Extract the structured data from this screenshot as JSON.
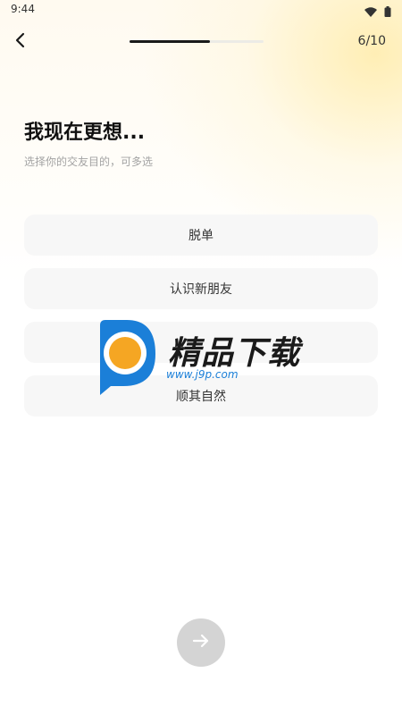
{
  "status_bar": {
    "time": "9:44",
    "icons": [
      "wifi-icon",
      "battery-icon"
    ]
  },
  "nav": {
    "back_icon": "chevron-left-icon",
    "progress": {
      "current": 6,
      "total": 10
    },
    "step_label": "6/10"
  },
  "header": {
    "title": "我现在更想...",
    "subtitle": "选择你的交友目的，可多选"
  },
  "options": [
    {
      "label": "脱单"
    },
    {
      "label": "认识新朋友"
    },
    {
      "label": ""
    },
    {
      "label": "顺其自然"
    }
  ],
  "watermark": {
    "title": "精品下载",
    "url": "www.j9p.com"
  },
  "next_button": {
    "icon": "arrow-right-icon"
  },
  "colors": {
    "accent": "#1a1a1a",
    "option_bg": "#f7f7f7",
    "button_disabled": "#d4d4d4",
    "watermark_blue": "#1b7fd8",
    "watermark_orange": "#f5a623"
  }
}
